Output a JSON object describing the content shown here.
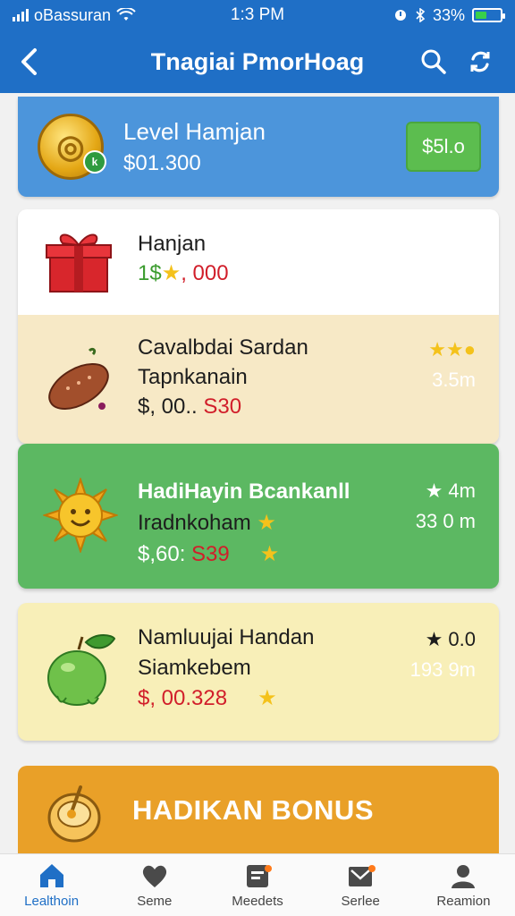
{
  "status": {
    "carrier": "oBassuran",
    "time": "1:3 PM",
    "battery": "33%",
    "battery_level": 0.33
  },
  "header": {
    "title": "Tnagiai PmorHoag",
    "back_icon": "back-icon",
    "search_icon": "search-icon",
    "refresh_icon": "refresh-icon"
  },
  "level_card": {
    "title": "Level Hamjan",
    "amount": "$01.300",
    "button": "$5l.o",
    "coin_badge": "k"
  },
  "items": [
    {
      "title": "Hanjan",
      "price_green": "1$",
      "price_red": ", 000",
      "icon": "gift-icon"
    },
    {
      "title": "Cavalbdai Sardan",
      "subtitle": "Tapnkanain",
      "price": "$, 00.. ",
      "price_red": "S30",
      "meta1": "★★●",
      "meta2": "3.5m",
      "icon": "sweet-potato-icon"
    }
  ],
  "green_card": {
    "title": "HadiHayin Bcankanll",
    "subtitle": "Iradnkoham",
    "price": "$,60: ",
    "price_red": "S39",
    "meta1": "★ 4m",
    "meta2": "33 0 m",
    "icon": "sun-icon"
  },
  "yellow_card": {
    "title": "Namluujai Handan",
    "subtitle": "Siamkebem",
    "price": "$, 00.328",
    "meta1": "★ 0.0",
    "meta2": "193 9m",
    "icon": "apple-icon"
  },
  "bonus": {
    "title": "HADIKAN BONUS",
    "icon": "honey-pot-icon"
  },
  "nav": [
    {
      "label": "Lealthoin",
      "icon": "home-icon",
      "active": true
    },
    {
      "label": "Seme",
      "icon": "heart-icon"
    },
    {
      "label": "Meedets",
      "icon": "clipboard-icon"
    },
    {
      "label": "Serlee",
      "icon": "envelope-icon"
    },
    {
      "label": "Reamion",
      "icon": "user-icon"
    }
  ],
  "colors": {
    "primary": "#1f6fc6",
    "level_card": "#4c95db",
    "green_button": "#5cbd4f",
    "green_card": "#5cb862",
    "yellow_card": "#f8efb8",
    "cream_row": "#f7e9c6",
    "bonus": "#e9a028",
    "price_red": "#d11e2a"
  }
}
